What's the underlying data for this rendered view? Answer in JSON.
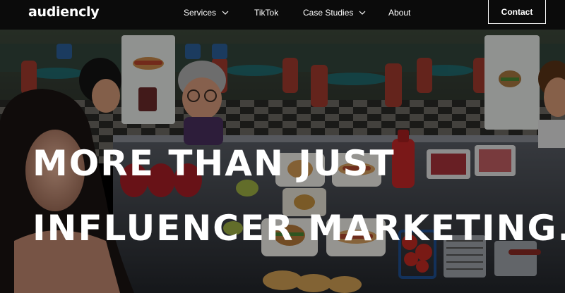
{
  "brand": {
    "logo_text": "audiencly"
  },
  "nav": {
    "items": [
      {
        "label": "Services",
        "has_dropdown": true
      },
      {
        "label": "TikTok",
        "has_dropdown": false
      },
      {
        "label": "Case Studies",
        "has_dropdown": true
      },
      {
        "label": "About",
        "has_dropdown": false
      }
    ],
    "contact_label": "Contact"
  },
  "hero": {
    "headline_line1": "MORE THAN JUST",
    "headline_line2": "INFLUENCER MARKETING.",
    "background_description_icon": "cartoon-diner-scene-image"
  },
  "colors": {
    "nav_bg": "#0b0b0b",
    "text": "#ffffff",
    "diner_red": "#c62828",
    "diner_teal": "#1f6f74"
  }
}
